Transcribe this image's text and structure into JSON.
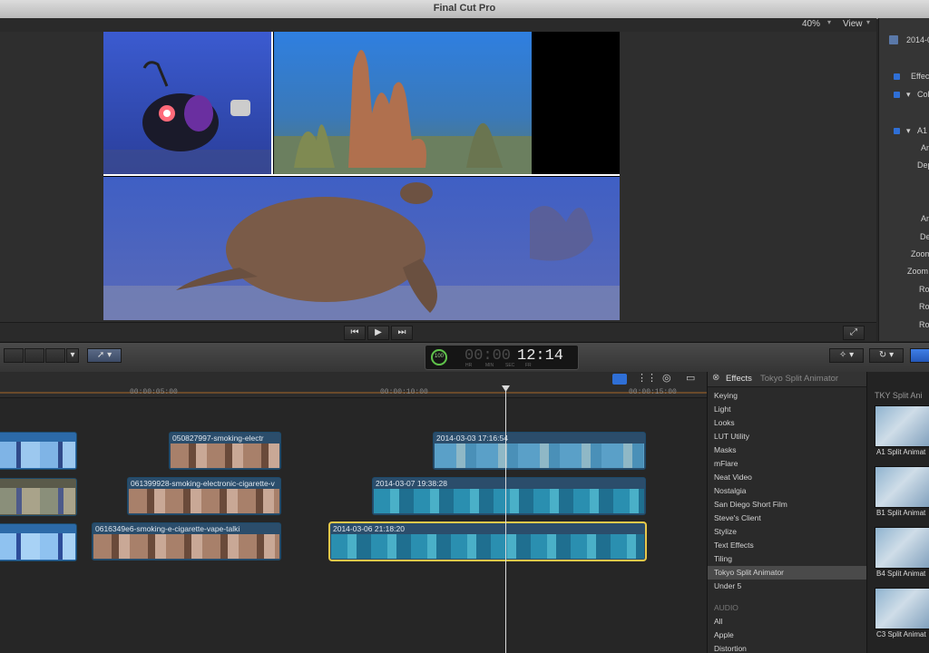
{
  "window": {
    "title": "Final Cut Pro"
  },
  "viewer": {
    "zoom": "40%",
    "view_label": "View"
  },
  "inspector": {
    "clip_name": "2014-0",
    "rows": [
      {
        "label": "Effec"
      },
      {
        "label": "Colo"
      },
      {
        "label": "A1"
      },
      {
        "label": "An"
      },
      {
        "label": "Dep"
      },
      {
        "label": "An"
      },
      {
        "label": "De"
      },
      {
        "label": "Zoom"
      },
      {
        "label": "Zoom"
      },
      {
        "label": "Ro"
      },
      {
        "label": "Ro"
      },
      {
        "label": "Ro"
      }
    ]
  },
  "timecode": {
    "value": "12:14",
    "dim": "00:00",
    "fps": "100",
    "units": [
      "HR",
      "MIN",
      "SEC",
      "FR"
    ]
  },
  "ruler": {
    "ticks": [
      "00:00:05:00",
      "00:00:10:00",
      "00:00:15:00"
    ]
  },
  "timeline": {
    "clips": [
      {
        "label": "050827997-smoking-electr",
        "type": "smoke"
      },
      {
        "label": "2014-03-03 17:16:54",
        "type": "water"
      },
      {
        "label": "061399928-smoking-electronic-cigarette-v",
        "type": "smoke"
      },
      {
        "label": "2014-03-07 19:38:28",
        "type": "reef"
      },
      {
        "label": "0616349e6-smoking-e-cigarette-vape-talki",
        "type": "smoke"
      },
      {
        "label": "2014-03-06 21:18:20",
        "type": "reef"
      }
    ]
  },
  "effects": {
    "header": "Effects",
    "selection": "Tokyo Split Animator",
    "items": [
      "Keying",
      "Light",
      "Looks",
      "LUT Utility",
      "Masks",
      "mFlare",
      "Neat Video",
      "Nostalgia",
      "San Diego Short Film",
      "Steve's Client",
      "Stylize",
      "Text Effects",
      "Tiling",
      "Tokyo Split Animator",
      "Under 5"
    ],
    "selected_index": 13,
    "audio_header": "AUDIO",
    "audio_items": [
      "All",
      "Apple",
      "Distortion"
    ]
  },
  "browser": {
    "header": "TKY Split Ani",
    "items": [
      "A1 Split Animat",
      "B1 Split Animat",
      "B4 Split Animat",
      "C3 Split Animat"
    ]
  },
  "colors": {
    "accent": "#2f6fd6",
    "selection": "#e8c84a",
    "playhead": "#d9d9d9"
  }
}
